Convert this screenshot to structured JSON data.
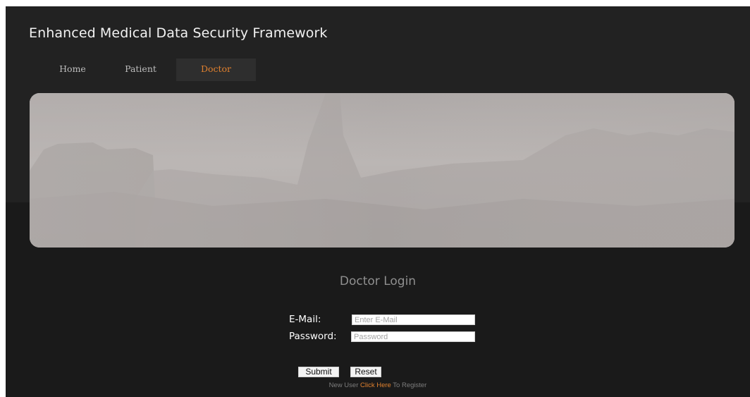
{
  "header": {
    "title": "Enhanced Medical Data Security Framework"
  },
  "nav": {
    "items": [
      {
        "label": "Home",
        "active": false
      },
      {
        "label": "Patient",
        "active": false
      },
      {
        "label": "Doctor",
        "active": true
      }
    ]
  },
  "banner": {
    "image": "foggy-hospital-buildings-photo"
  },
  "login": {
    "title": "Doctor Login",
    "email_label": "E-Mail:",
    "email_placeholder": "Enter E-Mail",
    "email_value": "",
    "password_label": "Password:",
    "password_placeholder": "Password",
    "password_value": "",
    "submit_label": "Submit",
    "reset_label": "Reset",
    "register_prefix": "New User",
    "register_link": "Click Here",
    "register_suffix": "To Register"
  },
  "colors": {
    "background": "#1a1a1a",
    "header_background": "#222222",
    "accent": "#e0802e",
    "title_text": "#f2f2f2",
    "muted_text": "#8f8f8f"
  }
}
